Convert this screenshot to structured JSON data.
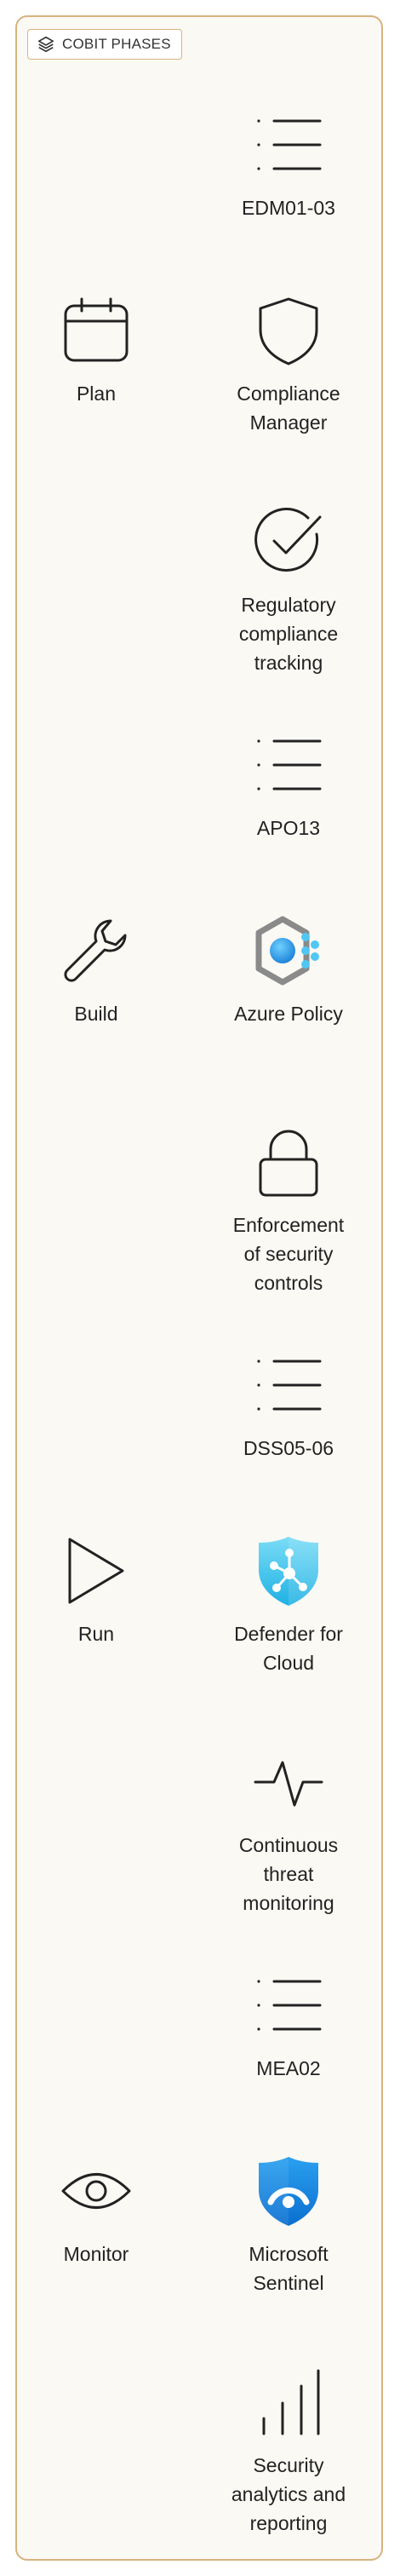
{
  "container": {
    "title": "COBIT PHASES",
    "title_icon": "layers-icon"
  },
  "phases": [
    {
      "label": "Plan",
      "icon": "calendar-icon"
    },
    {
      "label": "Build",
      "icon": "wrench-icon"
    },
    {
      "label": "Run",
      "icon": "play-icon"
    },
    {
      "label": "Monitor",
      "icon": "eye-icon"
    }
  ],
  "controls": [
    {
      "label": "EDM01-03",
      "icon": "list-icon"
    },
    {
      "label": "Compliance\nManager",
      "icon": "shield-icon"
    },
    {
      "label": "Regulatory\ncompliance\ntracking",
      "icon": "check-circle-icon"
    },
    {
      "label": "APO13",
      "icon": "list-icon"
    },
    {
      "label": "Azure Policy",
      "icon": "azure-policy-icon"
    },
    {
      "label": "Enforcement\nof security\ncontrols",
      "icon": "lock-icon"
    },
    {
      "label": "DSS05-06",
      "icon": "list-icon"
    },
    {
      "label": "Defender for\nCloud",
      "icon": "defender-shield-icon"
    },
    {
      "label": "Continuous\nthreat\nmonitoring",
      "icon": "pulse-icon"
    },
    {
      "label": "MEA02",
      "icon": "list-icon"
    },
    {
      "label": "Microsoft\nSentinel",
      "icon": "sentinel-shield-icon"
    },
    {
      "label": "Security\nanalytics and\nreporting",
      "icon": "bar-chart-icon"
    }
  ],
  "colors": {
    "frame_border": "#d7b37e",
    "frame_fill": "#fbf9f4",
    "outline_icon": "#222222",
    "azure_blue": "#1a8fe3",
    "defender_cyan": "#4fc6ee",
    "policy_grey": "#8a8a8a"
  }
}
